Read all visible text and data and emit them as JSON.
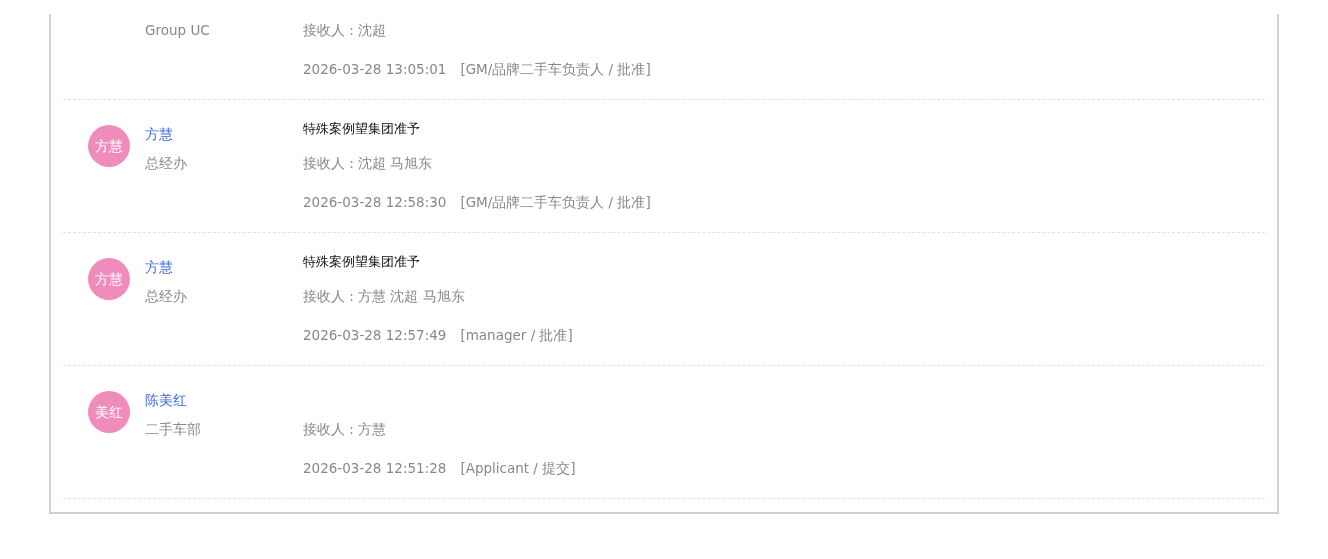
{
  "records": [
    {
      "department": "Group UC",
      "receivers": "接收人 : 沈超",
      "time": "2026-03-28 13:05:01",
      "role_action": "[GM/品牌二手车负责人 / 批准]"
    },
    {
      "avatar": "方慧",
      "name": "方慧",
      "department": "总经办",
      "comment": "特殊案例望集团准予",
      "receivers": "接收人 : 沈超 马旭东",
      "time": "2026-03-28 12:58:30",
      "role_action": "[GM/品牌二手车负责人 / 批准]"
    },
    {
      "avatar": "方慧",
      "name": "方慧",
      "department": "总经办",
      "comment": "特殊案例望集团准予",
      "receivers": "接收人 : 方慧 沈超 马旭东",
      "time": "2026-03-28 12:57:49",
      "role_action": "[manager / 批准]"
    },
    {
      "avatar": "美红",
      "name": "陈美红",
      "department": "二手车部",
      "receivers": "接收人 : 方慧",
      "time": "2026-03-28 12:51:28",
      "role_action": "[Applicant / 提交]"
    }
  ]
}
